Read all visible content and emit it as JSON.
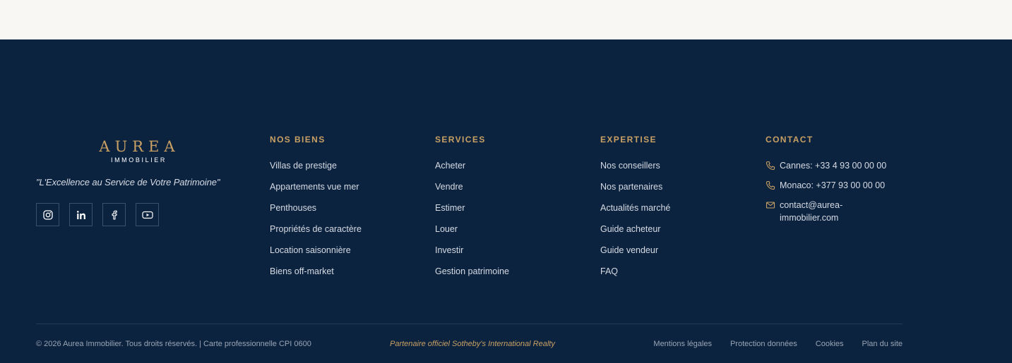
{
  "brand": {
    "logo_main": "AUREA",
    "logo_sub": "IMMOBILIER",
    "tagline": "\"L'Excellence au Service de Votre Patrimoine\""
  },
  "socials": [
    {
      "icon": "instagram-icon"
    },
    {
      "icon": "linkedin-icon"
    },
    {
      "icon": "facebook-icon"
    },
    {
      "icon": "youtube-icon"
    }
  ],
  "columns": [
    {
      "title": "NOS BIENS",
      "items": [
        "Villas de prestige",
        "Appartements vue mer",
        "Penthouses",
        "Propriétés de caractère",
        "Location saisonnière",
        "Biens off-market"
      ]
    },
    {
      "title": "SERVICES",
      "items": [
        "Acheter",
        "Vendre",
        "Estimer",
        "Louer",
        "Investir",
        "Gestion patrimoine"
      ]
    },
    {
      "title": "EXPERTISE",
      "items": [
        "Nos conseillers",
        "Nos partenaires",
        "Actualités marché",
        "Guide acheteur",
        "Guide vendeur",
        "FAQ"
      ]
    }
  ],
  "contact": {
    "title": "CONTACT",
    "cannes": "Cannes: +33 4 93 00 00 00",
    "monaco": "Monaco: +377 93 00 00 00",
    "email": "contact@aurea-immobilier.com"
  },
  "bottom": {
    "copyright": "© 2026 Aurea Immobilier. Tous droits réservés. | Carte professionnelle CPI 0600",
    "partner": "Partenaire officiel Sotheby's International Realty",
    "links": [
      "Mentions légales",
      "Protection données",
      "Cookies",
      "Plan du site"
    ]
  },
  "colors": {
    "background": "#0c2340",
    "top_band": "#f9f7f3",
    "accent": "#c9a063",
    "text": "#d6dbe3",
    "muted": "#9aa5b4"
  }
}
